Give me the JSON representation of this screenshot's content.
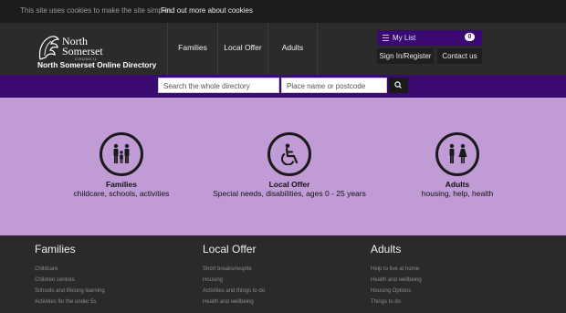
{
  "cookie": {
    "text": "This site uses cookies to make the site simpler.",
    "link": "Find out more about cookies"
  },
  "header": {
    "logo": {
      "line1": "North",
      "line2": "Somerset",
      "line3": "COUNCIL",
      "directory": "North Somerset Online Directory"
    },
    "nav": [
      {
        "label": "Families"
      },
      {
        "label": "Local Offer"
      },
      {
        "label": "Adults"
      }
    ],
    "mylist": {
      "label": "My List",
      "count": "0"
    },
    "signin": "Sign In/Register",
    "contact": "Contact us"
  },
  "search": {
    "directory_placeholder": "Search the whole directory",
    "postcode_placeholder": "Place name or postcode",
    "button_icon": "search-icon"
  },
  "tiles": [
    {
      "title": "Families",
      "sub": "childcare, schools, activities",
      "icon": "family-icon"
    },
    {
      "title": "Local Offer",
      "sub": "Special needs, disabilities, ages 0 - 25 years",
      "icon": "wheelchair-icon"
    },
    {
      "title": "Adults",
      "sub": "housing, help, health",
      "icon": "adults-icon"
    }
  ],
  "footer": {
    "columns": [
      {
        "heading": "Families",
        "items": [
          "Childcare",
          "Children centres",
          "Schools and lifelong learning",
          "Activities for the under 5s"
        ]
      },
      {
        "heading": "Local Offer",
        "items": [
          "Short breaks/respite",
          "Housing",
          "Activities and things to do",
          "Health and wellbeing"
        ]
      },
      {
        "heading": "Adults",
        "items": [
          "Help to live at home",
          "Health and wellbeing",
          "Housing Options",
          "Things to do"
        ]
      }
    ]
  },
  "colors": {
    "purple": "#3b0a70",
    "lavender": "#c09bd6",
    "dark": "#2b2b2b"
  }
}
